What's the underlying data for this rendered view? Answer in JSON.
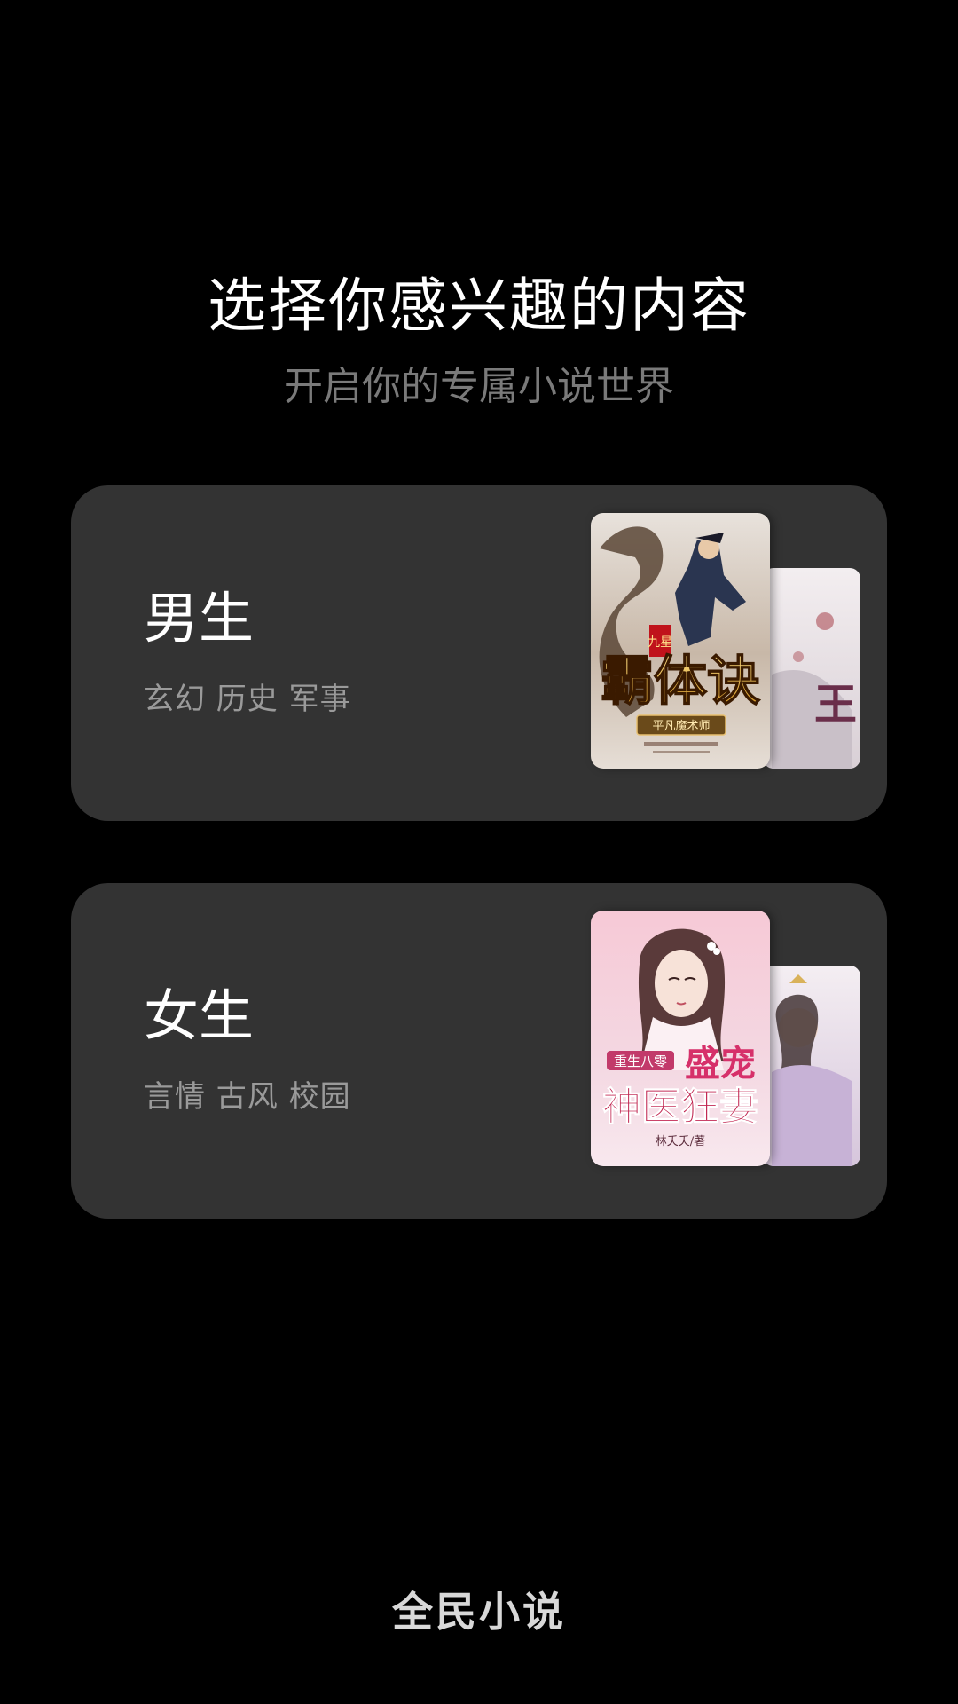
{
  "header": {
    "title": "选择你感兴趣的内容",
    "subtitle": "开启你的专属小说世界"
  },
  "cards": [
    {
      "title": "男生",
      "tags": "玄幻 历史 军事",
      "front_cover": {
        "title_text": "霸体诀",
        "series_mark": "九星",
        "author_text": "平凡魔术师"
      },
      "back_cover": {
        "visible_text": "王"
      }
    },
    {
      "title": "女生",
      "tags": "言情 古风 校园",
      "front_cover": {
        "top_text": "重生八零",
        "title_line1": "盛宠",
        "title_line2": "神医狂妻",
        "author_text": "林夭夭/著"
      },
      "back_cover": {}
    }
  ],
  "footer": {
    "brand": "全民小说"
  },
  "colors": {
    "background": "#000000",
    "card": "#333333",
    "title": "#ffffff",
    "subtitle": "#7a7a7a",
    "tags": "#9a9a9a"
  }
}
